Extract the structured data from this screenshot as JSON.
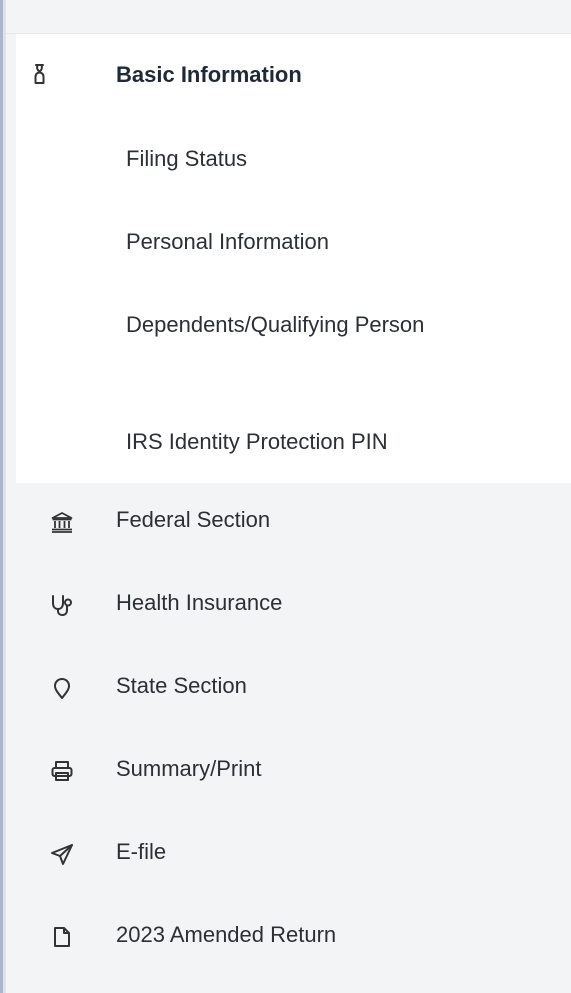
{
  "basic_information": {
    "label": "Basic Information",
    "icon": "person-info-icon",
    "expanded": true,
    "sub_items": [
      {
        "label": "Filing Status"
      },
      {
        "label": "Personal Information"
      },
      {
        "label": "Dependents/Qualifying Person"
      },
      {
        "label": "IRS Identity Protection PIN"
      }
    ]
  },
  "nav_items": [
    {
      "label": "Federal Section",
      "icon": "bank-icon"
    },
    {
      "label": "Health Insurance",
      "icon": "stethoscope-icon"
    },
    {
      "label": "State Section",
      "icon": "map-pin-icon"
    },
    {
      "label": "Summary/Print",
      "icon": "printer-icon"
    },
    {
      "label": "E-file",
      "icon": "send-icon"
    },
    {
      "label": "2023 Amended Return",
      "icon": "document-icon"
    }
  ],
  "colors": {
    "active_background": "#ffffff",
    "sidebar_background": "#f3f4f6",
    "text": "#2b2f36",
    "icon_stroke": "#333333"
  }
}
